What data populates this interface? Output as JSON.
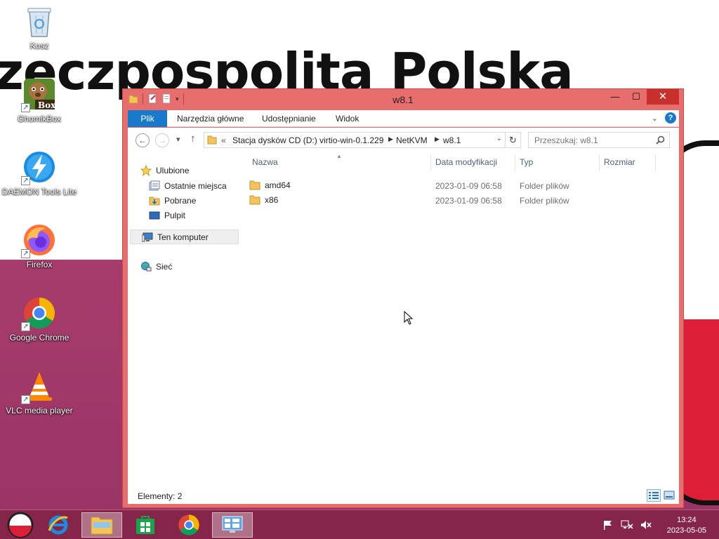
{
  "wallpaper": {
    "text": "zeczpospolita Polska"
  },
  "desktop": {
    "icons": [
      {
        "label": "Kosz",
        "icon": "recycle-bin-icon"
      },
      {
        "label": "GhomikBox",
        "icon": "gnomikbox-icon",
        "badge": "Box"
      },
      {
        "label": "DAEMON Tools Lite",
        "icon": "daemon-tools-icon"
      },
      {
        "label": "Firefox",
        "icon": "firefox-icon"
      },
      {
        "label": "Google Chrome",
        "icon": "chrome-icon"
      },
      {
        "label": "VLC media player",
        "icon": "vlc-icon"
      }
    ]
  },
  "window": {
    "title": "w8.1",
    "controls": {
      "minimize": "—",
      "maximize": "☐",
      "close": "✕"
    },
    "ribbon": {
      "tabs": [
        "Plik",
        "Narzędzia główne",
        "Udostępnianie",
        "Widok"
      ]
    },
    "address": {
      "prefix": "«",
      "crumbs": [
        "Stacja dysków CD (D:) virtio-win-0.1.229",
        "NetKVM",
        "w8.1"
      ]
    },
    "search": {
      "placeholder": "Przeszukaj: w8.1"
    },
    "navpane": {
      "favorites": "Ulubione",
      "favorite_items": [
        "Ostatnie miejsca",
        "Pobrane",
        "Pulpit"
      ],
      "computer": "Ten komputer",
      "network": "Sieć"
    },
    "columns": [
      "Nazwa",
      "Data modyfikacji",
      "Typ",
      "Rozmiar"
    ],
    "files": [
      {
        "name": "amd64",
        "date": "2023-01-09 06:58",
        "type": "Folder plików"
      },
      {
        "name": "x86",
        "date": "2023-01-09 06:58",
        "type": "Folder plików"
      }
    ],
    "status": {
      "count": "Elementy: 2"
    }
  },
  "taskbar": {
    "clock": {
      "time": "13:24",
      "date": "2023-05-05"
    }
  },
  "colors": {
    "window_frame": "#e86d6d",
    "accent": "#1979ca",
    "close": "#c7302b",
    "taskbar": "#822446"
  }
}
